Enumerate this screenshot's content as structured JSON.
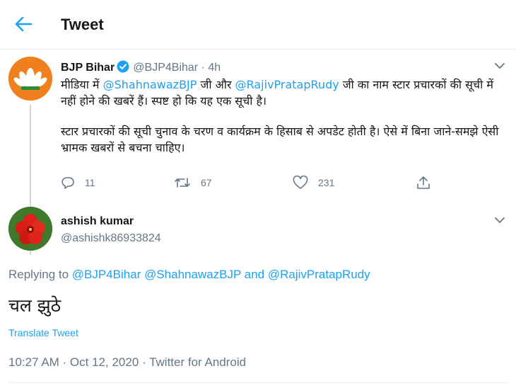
{
  "header": {
    "title": "Tweet",
    "back_icon": "back-arrow-icon"
  },
  "parent_tweet": {
    "display_name": "BJP Bihar",
    "handle": "@BJP4Bihar",
    "separator": " · ",
    "time": "4h",
    "text": {
      "p1_a": "मीडिया में ",
      "mention1": "@ShahnawazBJP",
      "p1_b": " जी और ",
      "mention2": "@RajivPratapRudy",
      "p1_c": " जी का नाम स्टार प्रचारकों की सूची में नहीं होने की खबरें हैं। स्पष्ट हो कि यह एक सूची है।",
      "p2": "स्टार प्रचारकों की सूची चुनाव के चरण व कार्यक्रम के हिसाब से अपडेट होती है। ऐसे में बिना जाने-समझे ऐसी भ्रामक खबरों से बचना चाहिए।"
    },
    "replies": "11",
    "retweets": "67",
    "likes": "231"
  },
  "reply_tweet": {
    "display_name": "ashish kumar",
    "handle": "@ashishk86933824",
    "replying_prefix": "Replying to ",
    "replying_to": "@BJP4Bihar @ShahnawazBJP and @RajivPratapRudy",
    "body": "चल झुठे",
    "translate_label": "Translate Tweet",
    "meta": "10:27 AM · Oct 12, 2020 · Twitter for Android"
  },
  "colors": {
    "accent": "#1da1f2",
    "muted": "#657786",
    "text": "#14171a"
  }
}
